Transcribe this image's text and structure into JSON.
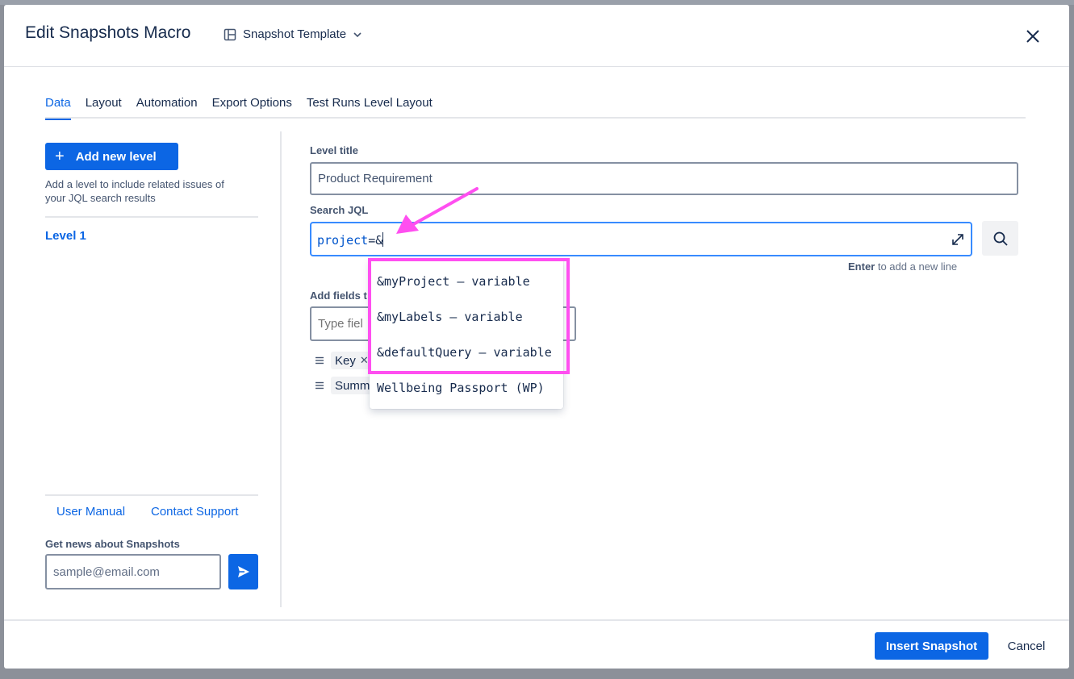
{
  "modal": {
    "title": "Edit Snapshots Macro",
    "template_label": "Snapshot Template"
  },
  "tabs": [
    {
      "label": "Data",
      "active": true
    },
    {
      "label": "Layout"
    },
    {
      "label": "Automation"
    },
    {
      "label": "Export Options"
    },
    {
      "label": "Test Runs Level Layout"
    }
  ],
  "sidebar": {
    "add_level_label": "Add new level",
    "add_level_help": "Add a level to include related issues of your JQL search results",
    "levels": [
      {
        "label": "Level 1"
      }
    ],
    "user_manual_link": "User Manual",
    "contact_support_link": "Contact Support",
    "news_label": "Get news about Snapshots",
    "email_placeholder": "sample@email.com"
  },
  "form": {
    "level_title_label": "Level title",
    "level_title_value": "Product Requirement",
    "search_jql_label": "Search JQL",
    "jql_keyword": "project",
    "jql_operator": "=&",
    "enter_hint_key": "Enter",
    "enter_hint_text": " to add a new line",
    "add_fields_label": "Add fields t",
    "type_fields_placeholder": "Type fiel",
    "fields": [
      {
        "label": "Key"
      },
      {
        "label": "Summa"
      }
    ]
  },
  "autocomplete": {
    "items": [
      {
        "label": "&myProject – variable"
      },
      {
        "label": "&myLabels – variable"
      },
      {
        "label": "&defaultQuery – variable"
      },
      {
        "label": "Wellbeing Passport (WP)"
      }
    ]
  },
  "annotation": {
    "highlight_color": "#ff4ff0"
  },
  "footer": {
    "insert_label": "Insert Snapshot",
    "cancel_label": "Cancel"
  },
  "colors": {
    "primary": "#0c66e4",
    "focus_border": "#388bff"
  }
}
